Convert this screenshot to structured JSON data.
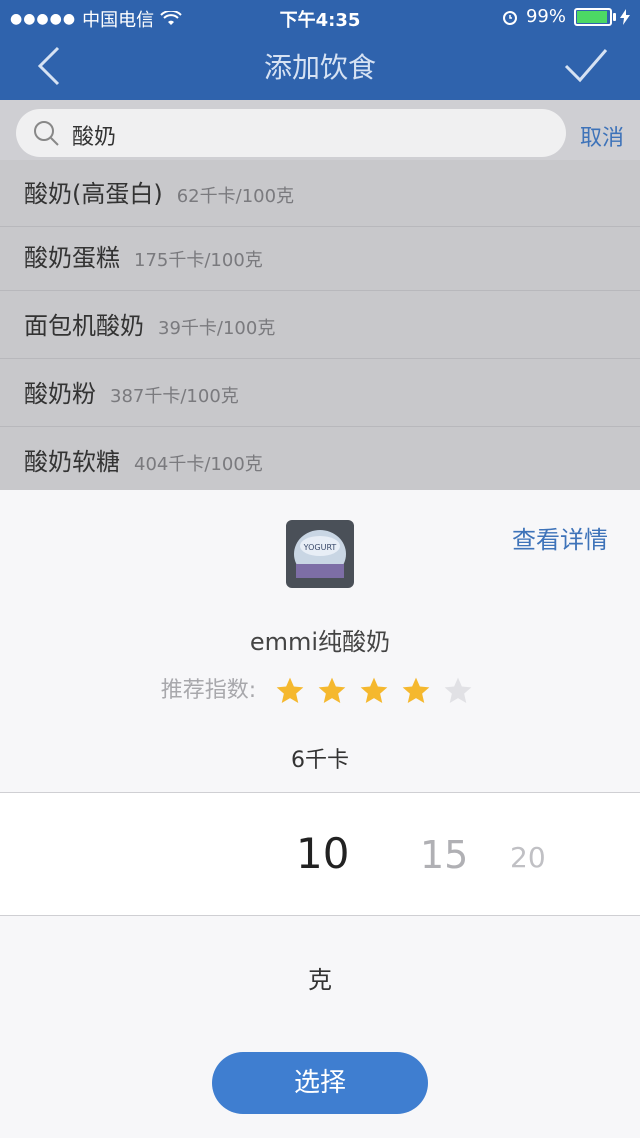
{
  "status": {
    "carrier": "中国电信",
    "time": "下午4:35",
    "battery": "99%",
    "battery_level": 0.99
  },
  "nav": {
    "title": "添加饮食"
  },
  "search": {
    "query": "酸奶",
    "cancel_label": "取消"
  },
  "results": [
    {
      "name": "酸奶(高蛋白)",
      "calories": "62千卡/100克"
    },
    {
      "name": "酸奶蛋糕",
      "calories": "175千卡/100克"
    },
    {
      "name": "面包机酸奶",
      "calories": "39千卡/100克"
    },
    {
      "name": "酸奶粉",
      "calories": "387千卡/100克"
    },
    {
      "name": "酸奶软糖",
      "calories": "404千卡/100克"
    }
  ],
  "sheet": {
    "detail_link": "查看详情",
    "image_text": "YOGURT",
    "food_name": "emmi纯酸奶",
    "rating_label": "推荐指数:",
    "rating": 4,
    "rating_max": 5,
    "kcal": "6千卡",
    "picker_values": [
      "10",
      "15",
      "20"
    ],
    "unit": "克",
    "select_label": "选择"
  },
  "colors": {
    "nav": "#2f63ad",
    "accent": "#3f7ed0",
    "star": "#f5b82e",
    "star_off": "#e1e1e5"
  }
}
